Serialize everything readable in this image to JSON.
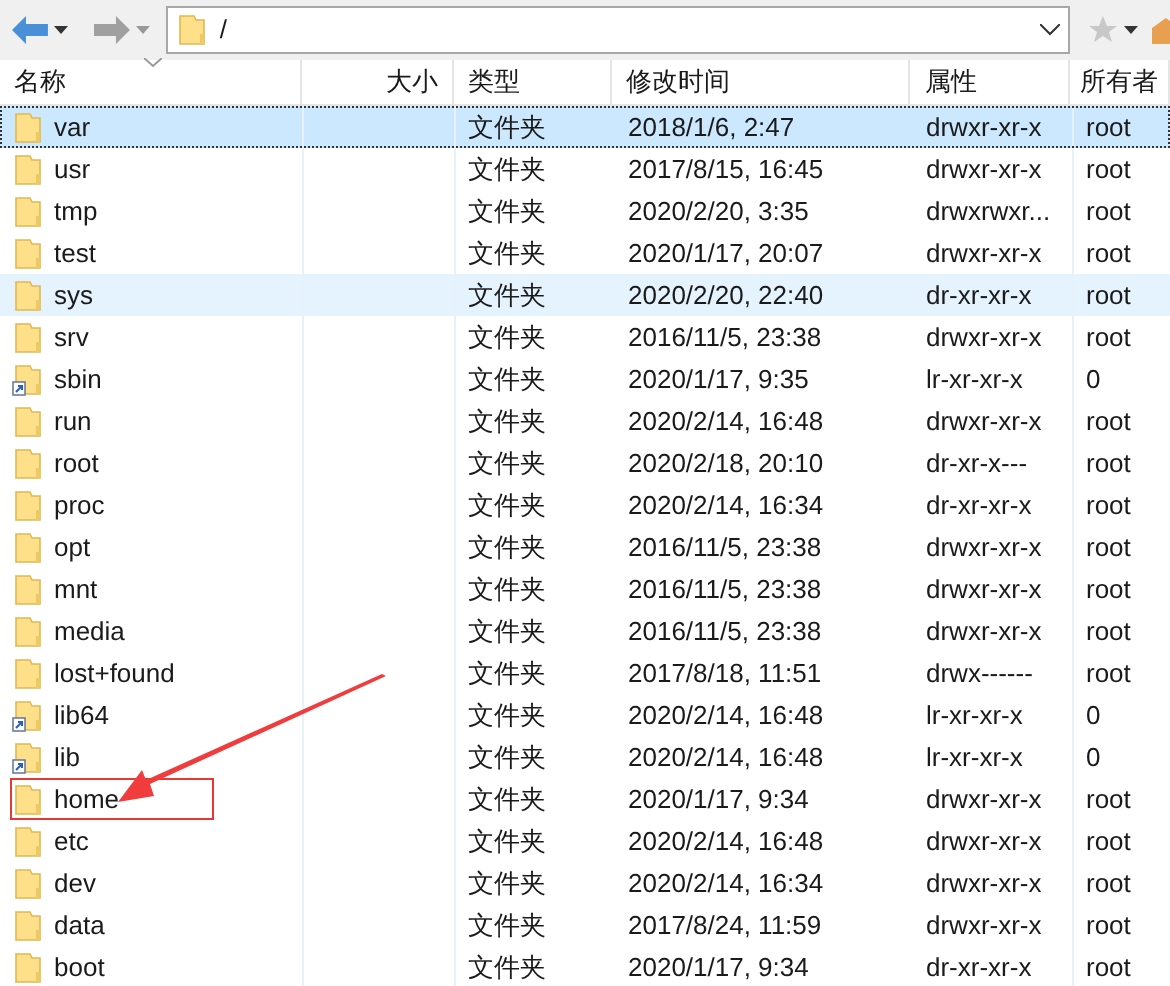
{
  "address_bar": {
    "path": "/"
  },
  "columns": [
    {
      "label": "名称",
      "sorted": true
    },
    {
      "label": "大小",
      "sorted": false
    },
    {
      "label": "类型",
      "sorted": false
    },
    {
      "label": "修改时间",
      "sorted": false
    },
    {
      "label": "属性",
      "sorted": false
    },
    {
      "label": "所有者",
      "sorted": false
    }
  ],
  "rows": [
    {
      "name": "var",
      "type": "文件夹",
      "modified": "2018/1/6, 2:47",
      "attributes": "drwxr-xr-x",
      "owner": "root",
      "link": false,
      "selected": true,
      "hovered": false,
      "highlighted": false
    },
    {
      "name": "usr",
      "type": "文件夹",
      "modified": "2017/8/15, 16:45",
      "attributes": "drwxr-xr-x",
      "owner": "root",
      "link": false,
      "selected": false,
      "hovered": false,
      "highlighted": false
    },
    {
      "name": "tmp",
      "type": "文件夹",
      "modified": "2020/2/20, 3:35",
      "attributes": "drwxrwxr...",
      "owner": "root",
      "link": false,
      "selected": false,
      "hovered": false,
      "highlighted": false
    },
    {
      "name": "test",
      "type": "文件夹",
      "modified": "2020/1/17, 20:07",
      "attributes": "drwxr-xr-x",
      "owner": "root",
      "link": false,
      "selected": false,
      "hovered": false,
      "highlighted": false
    },
    {
      "name": "sys",
      "type": "文件夹",
      "modified": "2020/2/20, 22:40",
      "attributes": "dr-xr-xr-x",
      "owner": "root",
      "link": false,
      "selected": false,
      "hovered": true,
      "highlighted": false
    },
    {
      "name": "srv",
      "type": "文件夹",
      "modified": "2016/11/5, 23:38",
      "attributes": "drwxr-xr-x",
      "owner": "root",
      "link": false,
      "selected": false,
      "hovered": false,
      "highlighted": false
    },
    {
      "name": "sbin",
      "type": "文件夹",
      "modified": "2020/1/17, 9:35",
      "attributes": "lr-xr-xr-x",
      "owner": "0",
      "link": true,
      "selected": false,
      "hovered": false,
      "highlighted": false
    },
    {
      "name": "run",
      "type": "文件夹",
      "modified": "2020/2/14, 16:48",
      "attributes": "drwxr-xr-x",
      "owner": "root",
      "link": false,
      "selected": false,
      "hovered": false,
      "highlighted": false
    },
    {
      "name": "root",
      "type": "文件夹",
      "modified": "2020/2/18, 20:10",
      "attributes": "dr-xr-x---",
      "owner": "root",
      "link": false,
      "selected": false,
      "hovered": false,
      "highlighted": false
    },
    {
      "name": "proc",
      "type": "文件夹",
      "modified": "2020/2/14, 16:34",
      "attributes": "dr-xr-xr-x",
      "owner": "root",
      "link": false,
      "selected": false,
      "hovered": false,
      "highlighted": false
    },
    {
      "name": "opt",
      "type": "文件夹",
      "modified": "2016/11/5, 23:38",
      "attributes": "drwxr-xr-x",
      "owner": "root",
      "link": false,
      "selected": false,
      "hovered": false,
      "highlighted": false
    },
    {
      "name": "mnt",
      "type": "文件夹",
      "modified": "2016/11/5, 23:38",
      "attributes": "drwxr-xr-x",
      "owner": "root",
      "link": false,
      "selected": false,
      "hovered": false,
      "highlighted": false
    },
    {
      "name": "media",
      "type": "文件夹",
      "modified": "2016/11/5, 23:38",
      "attributes": "drwxr-xr-x",
      "owner": "root",
      "link": false,
      "selected": false,
      "hovered": false,
      "highlighted": false
    },
    {
      "name": "lost+found",
      "type": "文件夹",
      "modified": "2017/8/18, 11:51",
      "attributes": "drwx------",
      "owner": "root",
      "link": false,
      "selected": false,
      "hovered": false,
      "highlighted": false
    },
    {
      "name": "lib64",
      "type": "文件夹",
      "modified": "2020/2/14, 16:48",
      "attributes": "lr-xr-xr-x",
      "owner": "0",
      "link": true,
      "selected": false,
      "hovered": false,
      "highlighted": false
    },
    {
      "name": "lib",
      "type": "文件夹",
      "modified": "2020/2/14, 16:48",
      "attributes": "lr-xr-xr-x",
      "owner": "0",
      "link": true,
      "selected": false,
      "hovered": false,
      "highlighted": false
    },
    {
      "name": "home",
      "type": "文件夹",
      "modified": "2020/1/17, 9:34",
      "attributes": "drwxr-xr-x",
      "owner": "root",
      "link": false,
      "selected": false,
      "hovered": false,
      "highlighted": true
    },
    {
      "name": "etc",
      "type": "文件夹",
      "modified": "2020/2/14, 16:48",
      "attributes": "drwxr-xr-x",
      "owner": "root",
      "link": false,
      "selected": false,
      "hovered": false,
      "highlighted": false
    },
    {
      "name": "dev",
      "type": "文件夹",
      "modified": "2020/2/14, 16:34",
      "attributes": "drwxr-xr-x",
      "owner": "root",
      "link": false,
      "selected": false,
      "hovered": false,
      "highlighted": false
    },
    {
      "name": "data",
      "type": "文件夹",
      "modified": "2017/8/24, 11:59",
      "attributes": "drwxr-xr-x",
      "owner": "root",
      "link": false,
      "selected": false,
      "hovered": false,
      "highlighted": false
    },
    {
      "name": "boot",
      "type": "文件夹",
      "modified": "2020/1/17, 9:34",
      "attributes": "dr-xr-xr-x",
      "owner": "root",
      "link": false,
      "selected": false,
      "hovered": false,
      "highlighted": false
    }
  ]
}
